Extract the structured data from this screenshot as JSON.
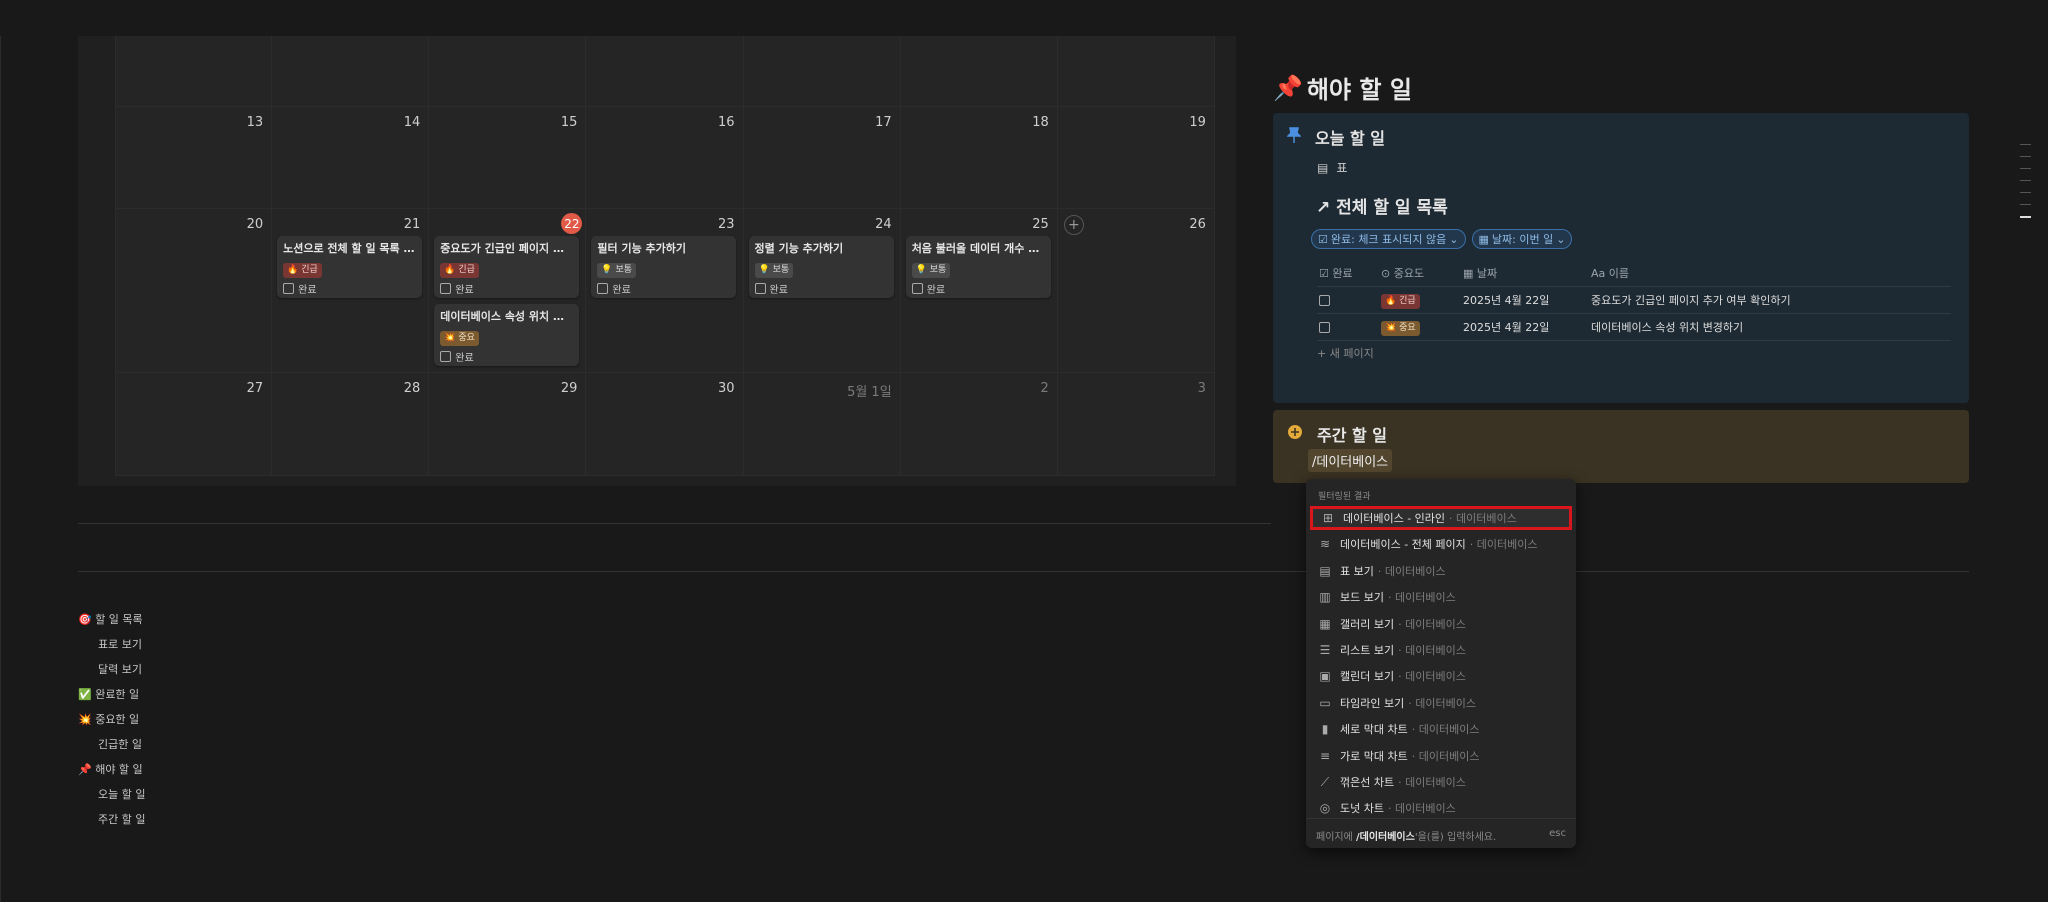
{
  "calendar": {
    "today_date": "22",
    "week0": [
      "",
      "",
      "",
      "",
      "",
      "",
      ""
    ],
    "week1": [
      "13",
      "14",
      "15",
      "16",
      "17",
      "18",
      "19"
    ],
    "week2": [
      "20",
      "21",
      "22",
      "23",
      "24",
      "25",
      "26"
    ],
    "week3": [
      "27",
      "28",
      "29",
      "30",
      "5월 1일",
      "2",
      "3"
    ],
    "add_symbol": "+",
    "cards": [
      {
        "title": "노션으로 전체 할 일 목록 만...",
        "tag": "🔥 긴급",
        "check": "완료"
      },
      {
        "title": "중요도가 긴급인 페이지 추...",
        "tag": "🔥 긴급",
        "check": "완료"
      },
      {
        "title": "필터 기능 추가하기",
        "tag": "💡 보통",
        "check": "완료"
      },
      {
        "title": "정렬 기능 추가하기",
        "tag": "💡 보통",
        "check": "완료"
      },
      {
        "title": "처음 불러올 데이터 개수 지...",
        "tag": "💡 보통",
        "check": "완료"
      },
      {
        "title": "데이터베이스 속성 위치 변...",
        "tag": "💥 중요",
        "check": "완료"
      }
    ]
  },
  "outline": [
    {
      "label": "🎯 할 일 목록",
      "indent": false
    },
    {
      "label": "표로 보기",
      "indent": true
    },
    {
      "label": "달력 보기",
      "indent": true
    },
    {
      "label": "✅ 완료한 일",
      "indent": false
    },
    {
      "label": "💥 중요한 일",
      "indent": false
    },
    {
      "label": "긴급한 일",
      "indent": true
    },
    {
      "label": "📌 해야 할 일",
      "indent": false
    },
    {
      "label": "오늘 할 일",
      "indent": true
    },
    {
      "label": "주간 할 일",
      "indent": true
    }
  ],
  "todo": {
    "title_icon": "📌",
    "title": "해야 할 일",
    "today": {
      "heading": "오늘 할 일",
      "view_label": "표",
      "db_title": "↗ 전체 할 일 목록",
      "filter1": "완료: 체크 표시되지 않음",
      "filter2": "날짜: 이번 일",
      "columns": [
        "완료",
        "중요도",
        "날짜",
        "이름"
      ],
      "column_icons": [
        "☑",
        "⊙",
        "▦",
        "Aa"
      ],
      "rows": [
        {
          "priority": "🔥 긴급",
          "date": "2025년 4월 22일",
          "name": "중요도가 긴급인 페이지 추가 여부 확인하기"
        },
        {
          "priority": "💥 중요",
          "date": "2025년 4월 22일",
          "name": "데이터베이스 속성 위치 변경하기"
        }
      ],
      "new_page": "새 페이지"
    },
    "weekly": {
      "heading": "주간 할 일",
      "slash_text": "/데이터베이스"
    }
  },
  "menu": {
    "section_label": "필터링된 결과",
    "items": [
      {
        "icon": "⊞",
        "label": "데이터베이스 - 인라인",
        "category": "데이터베이스"
      },
      {
        "icon": "≋",
        "label": "데이터베이스 - 전체 페이지",
        "category": "데이터베이스"
      },
      {
        "icon": "▤",
        "label": "표 보기",
        "category": "데이터베이스"
      },
      {
        "icon": "▥",
        "label": "보드 보기",
        "category": "데이터베이스"
      },
      {
        "icon": "▦",
        "label": "갤러리 보기",
        "category": "데이터베이스"
      },
      {
        "icon": "☰",
        "label": "리스트 보기",
        "category": "데이터베이스"
      },
      {
        "icon": "▣",
        "label": "캘린더 보기",
        "category": "데이터베이스"
      },
      {
        "icon": "▭",
        "label": "타임라인 보기",
        "category": "데이터베이스"
      },
      {
        "icon": "▮",
        "label": "세로 막대 차트",
        "category": "데이터베이스"
      },
      {
        "icon": "≡",
        "label": "가로 막대 차트",
        "category": "데이터베이스"
      },
      {
        "icon": "⟋",
        "label": "꺾은선 차트",
        "category": "데이터베이스"
      },
      {
        "icon": "◎",
        "label": "도넛 차트",
        "category": "데이터베이스"
      }
    ],
    "footer_prefix": "페이지에 ",
    "footer_cmd": "/데이터베이스",
    "footer_suffix": "'을(를) 입력하세요.",
    "footer_esc": "esc"
  }
}
